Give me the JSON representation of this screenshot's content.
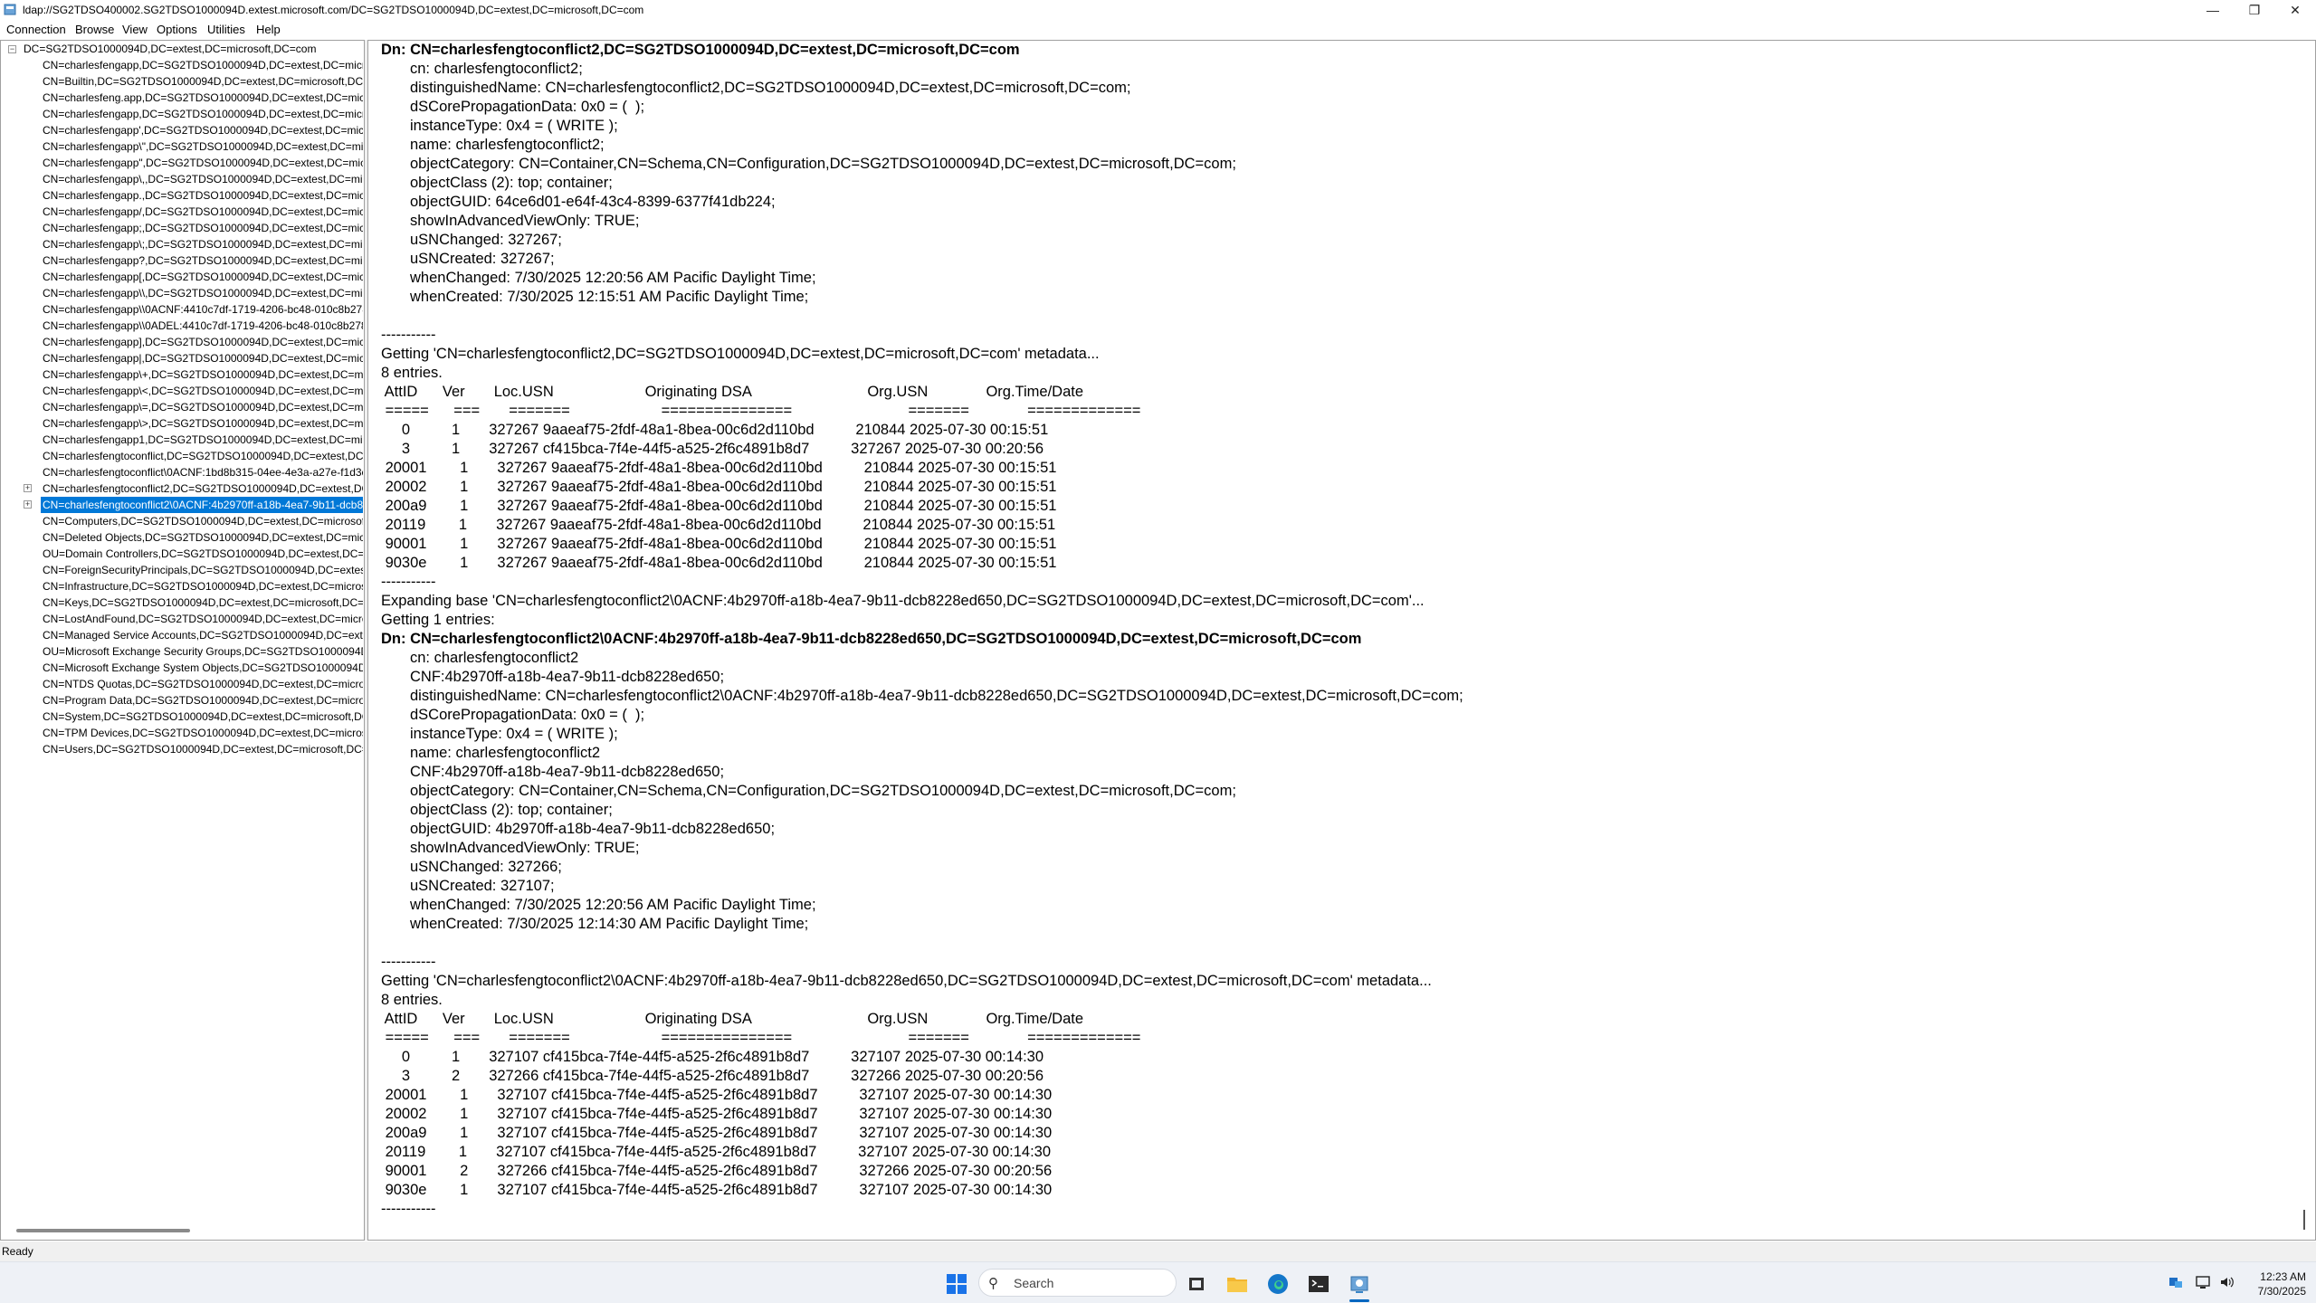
{
  "window": {
    "title": "ldap://SG2TDSO400002.SG2TDSO1000094D.extest.microsoft.com/DC=SG2TDSO1000094D,DC=extest,DC=microsoft,DC=com",
    "minimize_glyph": "—",
    "maximize_glyph": "❐",
    "close_glyph": "✕"
  },
  "menu": [
    "Connection",
    "Browse",
    "View",
    "Options",
    "Utilities",
    "Help"
  ],
  "tree": {
    "root": "DC=SG2TDSO1000094D,DC=extest,DC=microsoft,DC=com",
    "items": [
      {
        "label": "CN=charlesfengapp,DC=SG2TDSO1000094D,DC=extest,DC=micros"
      },
      {
        "label": "CN=Builtin,DC=SG2TDSO1000094D,DC=extest,DC=microsoft,DC=c"
      },
      {
        "label": "CN=charlesfeng.app,DC=SG2TDSO1000094D,DC=extest,DC=micros"
      },
      {
        "label": "CN=charlesfengapp,DC=SG2TDSO1000094D,DC=extest,DC=micros"
      },
      {
        "label": "CN=charlesfengapp',DC=SG2TDSO1000094D,DC=extest,DC=micros"
      },
      {
        "label": "CN=charlesfengapp\\\",DC=SG2TDSO1000094D,DC=extest,DC=micro"
      },
      {
        "label": "CN=charlesfengapp\",DC=SG2TDSO1000094D,DC=extest,DC=micro"
      },
      {
        "label": "CN=charlesfengapp\\,,DC=SG2TDSO1000094D,DC=extest,DC=micros"
      },
      {
        "label": "CN=charlesfengapp.,DC=SG2TDSO1000094D,DC=extest,DC=micros"
      },
      {
        "label": "CN=charlesfengapp/,DC=SG2TDSO1000094D,DC=extest,DC=micro"
      },
      {
        "label": "CN=charlesfengapp;,DC=SG2TDSO1000094D,DC=extest,DC=micros"
      },
      {
        "label": "CN=charlesfengapp\\;,DC=SG2TDSO1000094D,DC=extest,DC=micro"
      },
      {
        "label": "CN=charlesfengapp?,DC=SG2TDSO1000094D,DC=extest,DC=micros"
      },
      {
        "label": "CN=charlesfengapp[,DC=SG2TDSO1000094D,DC=extest,DC=micro"
      },
      {
        "label": "CN=charlesfengapp\\\\,DC=SG2TDSO1000094D,DC=extest,DC=micr"
      },
      {
        "label": "CN=charlesfengapp\\\\0ACNF:4410c7df-1719-4206-bc48-010c8b278a"
      },
      {
        "label": "CN=charlesfengapp\\\\0ADEL:4410c7df-1719-4206-bc48-010c8b278a"
      },
      {
        "label": "CN=charlesfengapp],DC=SG2TDSO1000094D,DC=extest,DC=micro"
      },
      {
        "label": "CN=charlesfengapp|,DC=SG2TDSO1000094D,DC=extest,DC=micros"
      },
      {
        "label": "CN=charlesfengapp\\+,DC=SG2TDSO1000094D,DC=extest,DC=micr"
      },
      {
        "label": "CN=charlesfengapp\\<,DC=SG2TDSO1000094D,DC=extest,DC=micr"
      },
      {
        "label": "CN=charlesfengapp\\=,DC=SG2TDSO1000094D,DC=extest,DC=micr"
      },
      {
        "label": "CN=charlesfengapp\\>,DC=SG2TDSO1000094D,DC=extest,DC=micr"
      },
      {
        "label": "CN=charlesfengapp1,DC=SG2TDSO1000094D,DC=extest,DC=micro"
      },
      {
        "label": "CN=charlesfengtoconflict,DC=SG2TDSO1000094D,DC=extest,DC=n"
      },
      {
        "label": "CN=charlesfengtoconflict\\0ACNF:1bd8b315-04ee-4e3a-a27e-f1d3c"
      },
      {
        "label": "CN=charlesfengtoconflict2,DC=SG2TDSO1000094D,DC=extest,DC=",
        "expander": "+"
      },
      {
        "label": "CN=charlesfengtoconflict2\\0ACNF:4b2970ff-a18b-4ea7-9b11-dcb8",
        "expander": "+",
        "selected": true
      },
      {
        "label": "CN=Computers,DC=SG2TDSO1000094D,DC=extest,DC=microsoft,D"
      },
      {
        "label": "CN=Deleted Objects,DC=SG2TDSO1000094D,DC=extest,DC=micros"
      },
      {
        "label": "OU=Domain Controllers,DC=SG2TDSO1000094D,DC=extest,DC=mi"
      },
      {
        "label": "CN=ForeignSecurityPrincipals,DC=SG2TDSO1000094D,DC=extest,D"
      },
      {
        "label": "CN=Infrastructure,DC=SG2TDSO1000094D,DC=extest,DC=microsof"
      },
      {
        "label": "CN=Keys,DC=SG2TDSO1000094D,DC=extest,DC=microsoft,DC=cor"
      },
      {
        "label": "CN=LostAndFound,DC=SG2TDSO1000094D,DC=extest,DC=microsc"
      },
      {
        "label": "CN=Managed Service Accounts,DC=SG2TDSO1000094D,DC=extest,"
      },
      {
        "label": "OU=Microsoft Exchange Security Groups,DC=SG2TDSO1000094D,"
      },
      {
        "label": "CN=Microsoft Exchange System Objects,DC=SG2TDSO1000094D,D"
      },
      {
        "label": "CN=NTDS Quotas,DC=SG2TDSO1000094D,DC=extest,DC=microsof"
      },
      {
        "label": "CN=Program Data,DC=SG2TDSO1000094D,DC=extest,DC=microsot"
      },
      {
        "label": "CN=System,DC=SG2TDSO1000094D,DC=extest,DC=microsoft,DC=c"
      },
      {
        "label": "CN=TPM Devices,DC=SG2TDSO1000094D,DC=extest,DC=microsoft"
      },
      {
        "label": "CN=Users,DC=SG2TDSO1000094D,DC=extest,DC=microsoft,DC=co"
      }
    ]
  },
  "details": {
    "lines": [
      {
        "t": "Dn: CN=charlesfengtoconflict2,DC=SG2TDSO1000094D,DC=extest,DC=microsoft,DC=com",
        "s": "bold"
      },
      {
        "t": "cn: charlesfengtoconflict2;",
        "s": "indent"
      },
      {
        "t": "distinguishedName: CN=charlesfengtoconflict2,DC=SG2TDSO1000094D,DC=extest,DC=microsoft,DC=com;",
        "s": "indent"
      },
      {
        "t": "dSCorePropagationData: 0x0 = (  );",
        "s": "indent"
      },
      {
        "t": "instanceType: 0x4 = ( WRITE );",
        "s": "indent"
      },
      {
        "t": "name: charlesfengtoconflict2;",
        "s": "indent"
      },
      {
        "t": "objectCategory: CN=Container,CN=Schema,CN=Configuration,DC=SG2TDSO1000094D,DC=extest,DC=microsoft,DC=com;",
        "s": "indent"
      },
      {
        "t": "objectClass (2): top; container;",
        "s": "indent"
      },
      {
        "t": "objectGUID: 64ce6d01-e64f-43c4-8399-6377f41db224;",
        "s": "indent"
      },
      {
        "t": "showInAdvancedViewOnly: TRUE;",
        "s": "indent"
      },
      {
        "t": "uSNChanged: 327267;",
        "s": "indent"
      },
      {
        "t": "uSNCreated: 327267;",
        "s": "indent"
      },
      {
        "t": "whenChanged: 7/30/2025 12:20:56 AM Pacific Daylight Time;",
        "s": "indent"
      },
      {
        "t": "whenCreated: 7/30/2025 12:15:51 AM Pacific Daylight Time;",
        "s": "indent"
      },
      {
        "t": "",
        "s": ""
      },
      {
        "t": "-----------",
        "s": ""
      },
      {
        "t": "Getting 'CN=charlesfengtoconflict2,DC=SG2TDSO1000094D,DC=extest,DC=microsoft,DC=com' metadata...",
        "s": ""
      },
      {
        "t": "8 entries.",
        "s": ""
      },
      {
        "t": " AttID      Ver       Loc.USN                      Originating DSA                            Org.USN              Org.Time/Date",
        "s": ""
      },
      {
        "t": " =====      ===       =======                      ===============                            =======              =============",
        "s": ""
      },
      {
        "t": "     0          1       327267 9aaeaf75-2fdf-48a1-8bea-00c6d2d110bd          210844 2025-07-30 00:15:51",
        "s": ""
      },
      {
        "t": "     3          1       327267 cf415bca-7f4e-44f5-a525-2f6c4891b8d7          327267 2025-07-30 00:20:56",
        "s": ""
      },
      {
        "t": " 20001        1       327267 9aaeaf75-2fdf-48a1-8bea-00c6d2d110bd          210844 2025-07-30 00:15:51",
        "s": ""
      },
      {
        "t": " 20002        1       327267 9aaeaf75-2fdf-48a1-8bea-00c6d2d110bd          210844 2025-07-30 00:15:51",
        "s": ""
      },
      {
        "t": " 200a9        1       327267 9aaeaf75-2fdf-48a1-8bea-00c6d2d110bd          210844 2025-07-30 00:15:51",
        "s": ""
      },
      {
        "t": " 20119        1       327267 9aaeaf75-2fdf-48a1-8bea-00c6d2d110bd          210844 2025-07-30 00:15:51",
        "s": ""
      },
      {
        "t": " 90001        1       327267 9aaeaf75-2fdf-48a1-8bea-00c6d2d110bd          210844 2025-07-30 00:15:51",
        "s": ""
      },
      {
        "t": " 9030e        1       327267 9aaeaf75-2fdf-48a1-8bea-00c6d2d110bd          210844 2025-07-30 00:15:51",
        "s": ""
      },
      {
        "t": "-----------",
        "s": ""
      },
      {
        "t": "Expanding base 'CN=charlesfengtoconflict2\\0ACNF:4b2970ff-a18b-4ea7-9b11-dcb8228ed650,DC=SG2TDSO1000094D,DC=extest,DC=microsoft,DC=com'...",
        "s": ""
      },
      {
        "t": "Getting 1 entries:",
        "s": ""
      },
      {
        "t": "Dn: CN=charlesfengtoconflict2\\0ACNF:4b2970ff-a18b-4ea7-9b11-dcb8228ed650,DC=SG2TDSO1000094D,DC=extest,DC=microsoft,DC=com",
        "s": "bold"
      },
      {
        "t": "cn: charlesfengtoconflict2",
        "s": "indent"
      },
      {
        "t": "CNF:4b2970ff-a18b-4ea7-9b11-dcb8228ed650;",
        "s": "indent"
      },
      {
        "t": "distinguishedName: CN=charlesfengtoconflict2\\0ACNF:4b2970ff-a18b-4ea7-9b11-dcb8228ed650,DC=SG2TDSO1000094D,DC=extest,DC=microsoft,DC=com;",
        "s": "indent"
      },
      {
        "t": "dSCorePropagationData: 0x0 = (  );",
        "s": "indent"
      },
      {
        "t": "instanceType: 0x4 = ( WRITE );",
        "s": "indent"
      },
      {
        "t": "name: charlesfengtoconflict2",
        "s": "indent"
      },
      {
        "t": "CNF:4b2970ff-a18b-4ea7-9b11-dcb8228ed650;",
        "s": "indent"
      },
      {
        "t": "objectCategory: CN=Container,CN=Schema,CN=Configuration,DC=SG2TDSO1000094D,DC=extest,DC=microsoft,DC=com;",
        "s": "indent"
      },
      {
        "t": "objectClass (2): top; container;",
        "s": "indent"
      },
      {
        "t": "objectGUID: 4b2970ff-a18b-4ea7-9b11-dcb8228ed650;",
        "s": "indent"
      },
      {
        "t": "showInAdvancedViewOnly: TRUE;",
        "s": "indent"
      },
      {
        "t": "uSNChanged: 327266;",
        "s": "indent"
      },
      {
        "t": "uSNCreated: 327107;",
        "s": "indent"
      },
      {
        "t": "whenChanged: 7/30/2025 12:20:56 AM Pacific Daylight Time;",
        "s": "indent"
      },
      {
        "t": "whenCreated: 7/30/2025 12:14:30 AM Pacific Daylight Time;",
        "s": "indent"
      },
      {
        "t": "",
        "s": ""
      },
      {
        "t": "-----------",
        "s": ""
      },
      {
        "t": "Getting 'CN=charlesfengtoconflict2\\0ACNF:4b2970ff-a18b-4ea7-9b11-dcb8228ed650,DC=SG2TDSO1000094D,DC=extest,DC=microsoft,DC=com' metadata...",
        "s": ""
      },
      {
        "t": "8 entries.",
        "s": ""
      },
      {
        "t": " AttID      Ver       Loc.USN                      Originating DSA                            Org.USN              Org.Time/Date",
        "s": ""
      },
      {
        "t": " =====      ===       =======                      ===============                            =======              =============",
        "s": ""
      },
      {
        "t": "     0          1       327107 cf415bca-7f4e-44f5-a525-2f6c4891b8d7          327107 2025-07-30 00:14:30",
        "s": ""
      },
      {
        "t": "     3          2       327266 cf415bca-7f4e-44f5-a525-2f6c4891b8d7          327266 2025-07-30 00:20:56",
        "s": ""
      },
      {
        "t": " 20001        1       327107 cf415bca-7f4e-44f5-a525-2f6c4891b8d7          327107 2025-07-30 00:14:30",
        "s": ""
      },
      {
        "t": " 20002        1       327107 cf415bca-7f4e-44f5-a525-2f6c4891b8d7          327107 2025-07-30 00:14:30",
        "s": ""
      },
      {
        "t": " 200a9        1       327107 cf415bca-7f4e-44f5-a525-2f6c4891b8d7          327107 2025-07-30 00:14:30",
        "s": ""
      },
      {
        "t": " 20119        1       327107 cf415bca-7f4e-44f5-a525-2f6c4891b8d7          327107 2025-07-30 00:14:30",
        "s": ""
      },
      {
        "t": " 90001        2       327266 cf415bca-7f4e-44f5-a525-2f6c4891b8d7          327266 2025-07-30 00:20:56",
        "s": ""
      },
      {
        "t": " 9030e        1       327107 cf415bca-7f4e-44f5-a525-2f6c4891b8d7          327107 2025-07-30 00:14:30",
        "s": ""
      },
      {
        "t": "-----------",
        "s": ""
      }
    ]
  },
  "status": {
    "text": "Ready"
  },
  "taskbar": {
    "search_placeholder": "Search",
    "search_glyph": "⚲",
    "icons": [
      {
        "name": "start-icon",
        "glyph": "⊞",
        "color": "#1a73e8"
      },
      {
        "name": "task-view-icon",
        "glyph": "▣",
        "color": "#333333"
      },
      {
        "name": "file-explorer-icon",
        "glyph": "▬",
        "color": "#e8a317"
      },
      {
        "name": "edge-icon",
        "glyph": "◉",
        "color": "#1477c9"
      },
      {
        "name": "terminal-icon",
        "glyph": "▮",
        "color": "#2b2b2b"
      },
      {
        "name": "ldp-app-icon",
        "glyph": "⚙",
        "color": "#3a86c8"
      }
    ],
    "tray_icons": [
      {
        "name": "tray-app-icon",
        "glyph": "●"
      },
      {
        "name": "network-icon",
        "glyph": "▭"
      },
      {
        "name": "volume-icon",
        "glyph": "🔈"
      }
    ],
    "time": "12:23 AM",
    "date": "7/30/2025"
  }
}
